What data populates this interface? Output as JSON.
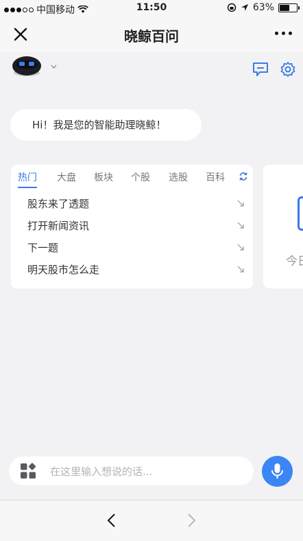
{
  "status_bar": {
    "carrier": "中国移动",
    "time": "11:50",
    "battery": "63%",
    "battery_level": 0.63
  },
  "nav": {
    "title": "晓鲸百问"
  },
  "greeting": "Hi！我是您的智能助理晓鲸！",
  "card": {
    "tabs": [
      "热门",
      "大盘",
      "板块",
      "个股",
      "选股",
      "百科"
    ],
    "active_tab": "热门",
    "questions": [
      "股东来了透题",
      "打开新闻资讯",
      "下一题",
      "明天股市怎么走"
    ]
  },
  "card2": {
    "partial_text": "今日"
  },
  "input": {
    "placeholder": "在这里输入想说的话...",
    "value": ""
  },
  "colors": {
    "accent": "#3b7ae8",
    "mic": "#3c86f3",
    "background": "#f2f2f4"
  },
  "icons": [
    "close-icon",
    "more-icon",
    "robot-avatar",
    "chevron-down-icon",
    "message-icon",
    "gear-icon",
    "refresh-icon",
    "arrow-down-right-icon",
    "apps-icon",
    "microphone-icon",
    "back-icon",
    "forward-icon"
  ]
}
